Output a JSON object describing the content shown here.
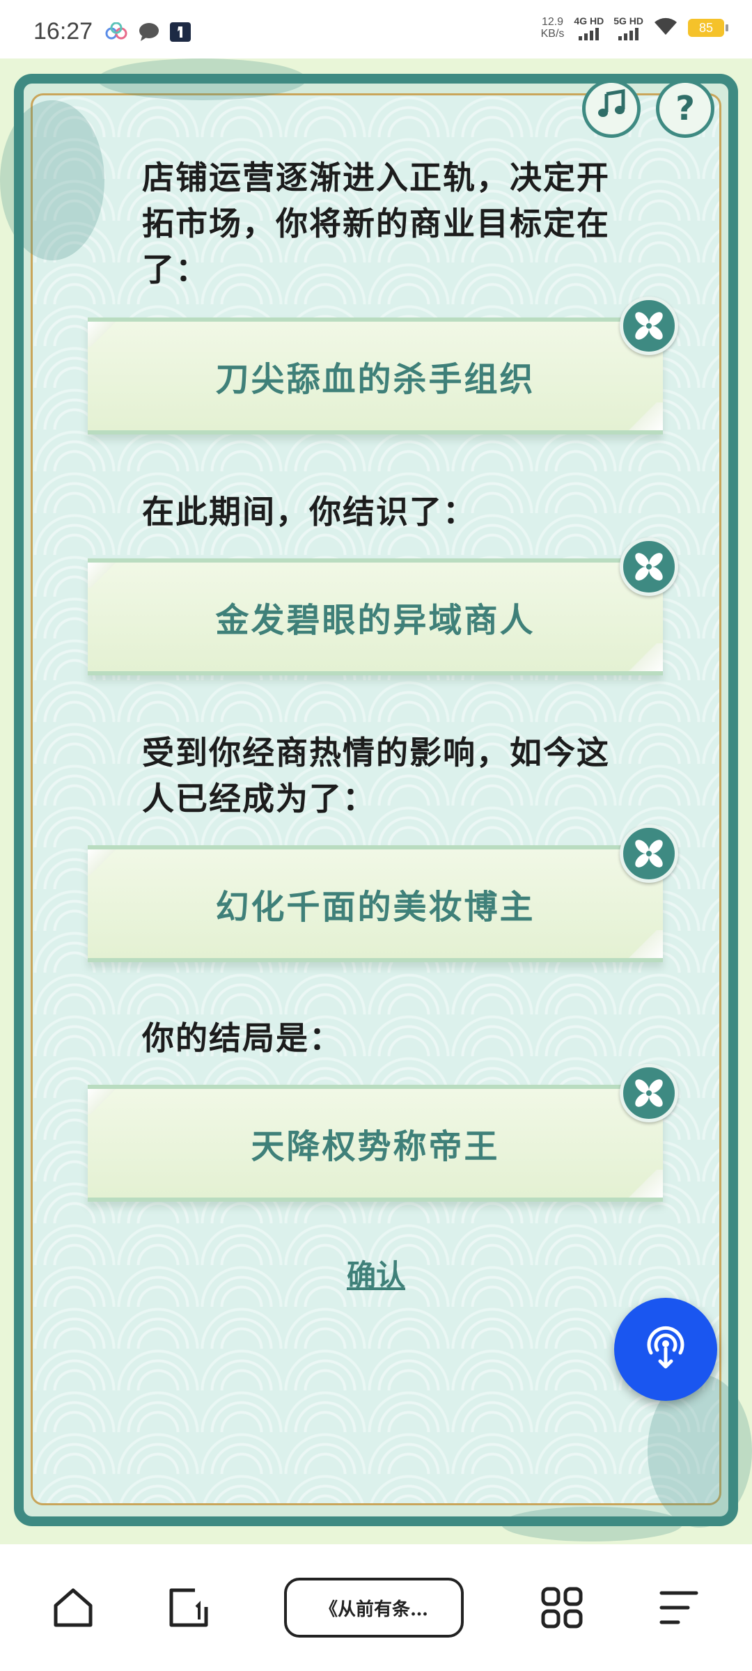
{
  "status_bar": {
    "time": "16:27",
    "net_speed_value": "12.9",
    "net_speed_unit": "KB/s",
    "signal1_label": "4G HD",
    "signal2_label": "5G HD",
    "battery": "85"
  },
  "game": {
    "questions": [
      {
        "text": "店铺运营逐渐进入正轨，决定开拓市场，你将新的商业目标定在了：",
        "answer": "刀尖舔血的杀手组织"
      },
      {
        "text": "在此期间，你结识了：",
        "answer": "金发碧眼的异域商人"
      },
      {
        "text": "受到你经商热情的影响，如今这人已经成为了：",
        "answer": "幻化千面的美妆博主"
      },
      {
        "text": "你的结局是：",
        "answer": "天降权势称帝王"
      }
    ],
    "confirm_label": "确认",
    "music_icon": "music-note-icon",
    "help_glyph": "?",
    "colors": {
      "frame": "#3e8a82",
      "accent_text": "#3f8079",
      "fab": "#1a56f0"
    }
  },
  "bottom_nav": {
    "title": "《从前有条…"
  }
}
